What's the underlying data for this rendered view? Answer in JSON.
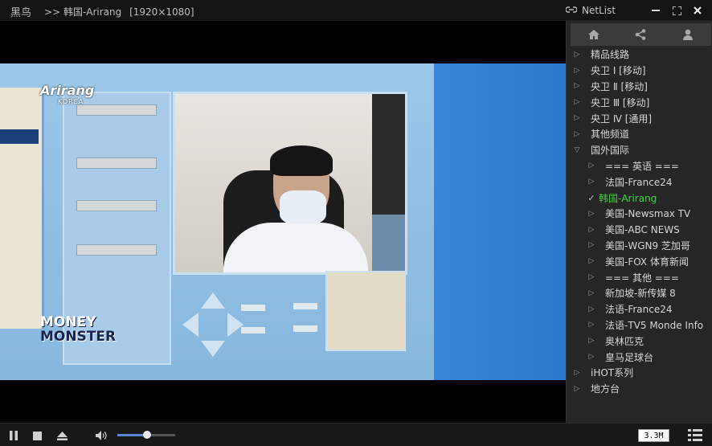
{
  "app": {
    "name": "黑鸟"
  },
  "now_playing": {
    "prefix": ">>",
    "channel": "韩国-Arirang",
    "resolution": "[1920×1080]"
  },
  "netlist": {
    "title": "NetList",
    "toolbar": [
      "home-icon",
      "share-icon",
      "user-icon"
    ],
    "items": [
      {
        "label": "精品线路",
        "level": 0,
        "state": "collapsed"
      },
      {
        "label": "央卫 Ⅰ [移动]",
        "level": 0,
        "state": "collapsed"
      },
      {
        "label": "央卫 Ⅱ [移动]",
        "level": 0,
        "state": "collapsed"
      },
      {
        "label": "央卫 Ⅲ [移动]",
        "level": 0,
        "state": "collapsed"
      },
      {
        "label": "央卫 Ⅳ [通用]",
        "level": 0,
        "state": "collapsed"
      },
      {
        "label": "其他频道",
        "level": 0,
        "state": "collapsed"
      },
      {
        "label": "国外国际",
        "level": 0,
        "state": "expanded"
      },
      {
        "label": "=== 英语 ===",
        "level": 1,
        "state": "collapsed"
      },
      {
        "label": "法国-France24",
        "level": 1,
        "state": "collapsed"
      },
      {
        "label": "韩国-Arirang",
        "level": 1,
        "state": "active"
      },
      {
        "label": "美国-Newsmax TV",
        "level": 1,
        "state": "collapsed"
      },
      {
        "label": "美国-ABC NEWS",
        "level": 1,
        "state": "collapsed"
      },
      {
        "label": "美国-WGN9 芝加哥",
        "level": 1,
        "state": "collapsed"
      },
      {
        "label": "美国-FOX 体育新闻",
        "level": 1,
        "state": "collapsed"
      },
      {
        "label": "=== 其他 ===",
        "level": 1,
        "state": "collapsed"
      },
      {
        "label": "新加坡-新传媒 8",
        "level": 1,
        "state": "collapsed"
      },
      {
        "label": "法语-France24",
        "level": 1,
        "state": "collapsed"
      },
      {
        "label": "法语-TV5 Monde Info",
        "level": 1,
        "state": "collapsed"
      },
      {
        "label": "奥林匹克",
        "level": 1,
        "state": "collapsed"
      },
      {
        "label": "皇马足球台",
        "level": 1,
        "state": "collapsed"
      },
      {
        "label": "iHOT系列",
        "level": 0,
        "state": "collapsed"
      },
      {
        "label": "地方台",
        "level": 0,
        "state": "collapsed"
      }
    ]
  },
  "video": {
    "channel_watermark": "Arirang",
    "channel_watermark_sub": "KOREA",
    "show_logo_line1": "MONEY",
    "show_logo_line2": "MONSTER"
  },
  "controls": {
    "volume_fraction": 0.52,
    "bitrate": "3.3M"
  },
  "colors": {
    "active_item": "#3ed13e",
    "volume_fill": "#5a87d6",
    "panel_bg": "#262626"
  }
}
